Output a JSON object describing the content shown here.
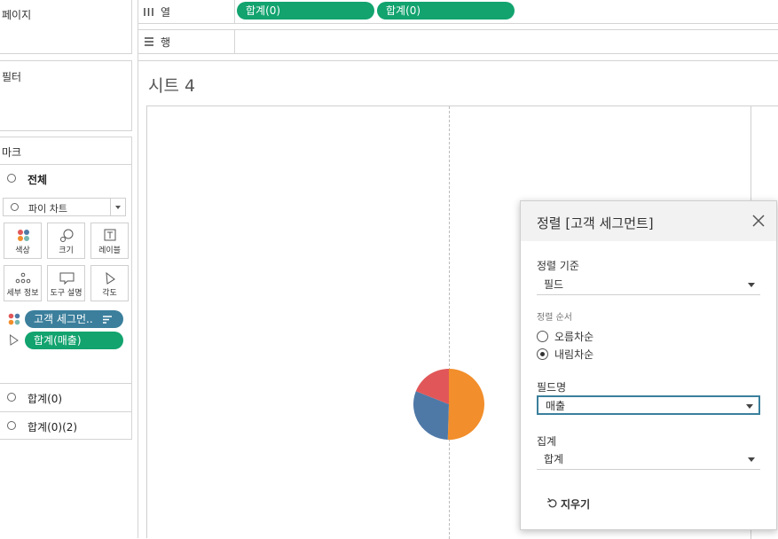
{
  "shelves": {
    "pages_label": "페이지",
    "columns_label": "열",
    "rows_label": "행",
    "columns_pills": [
      "합계(0)",
      "합계(0)"
    ]
  },
  "filters": {
    "label": "필터"
  },
  "marks": {
    "label": "마크",
    "all_label": "전체",
    "mark_type": "파이 차트",
    "buttons": {
      "color": "색상",
      "size": "크기",
      "label": "레이블",
      "detail": "세부 정보",
      "tooltip": "도구 설명",
      "angle": "각도"
    },
    "pills": [
      {
        "text": "고객 세그먼..",
        "color": "#3b7f9c"
      },
      {
        "text": "합계(매출)",
        "color": "#12a36f"
      }
    ],
    "sections": [
      "합계(0)",
      "합계(0)(2)"
    ]
  },
  "sheet": {
    "title": "시트 4"
  },
  "pie": {
    "slices": [
      {
        "value": 50.5,
        "color": "#f28e2b"
      },
      {
        "value": 30.5,
        "color": "#4e79a7"
      },
      {
        "value": 19.0,
        "color": "#e15759"
      }
    ]
  },
  "sort_dialog": {
    "title": "정렬 [고객 세그먼트]",
    "sort_by_label": "정렬 기준",
    "sort_by_value": "필드",
    "order_label": "정렬 순서",
    "ascending": "오름차순",
    "descending": "내림차순",
    "selected_order": "descending",
    "field_label": "필드명",
    "field_value": "매출",
    "aggregate_label": "집계",
    "aggregate_value": "합계",
    "clear_button": "지우기"
  }
}
